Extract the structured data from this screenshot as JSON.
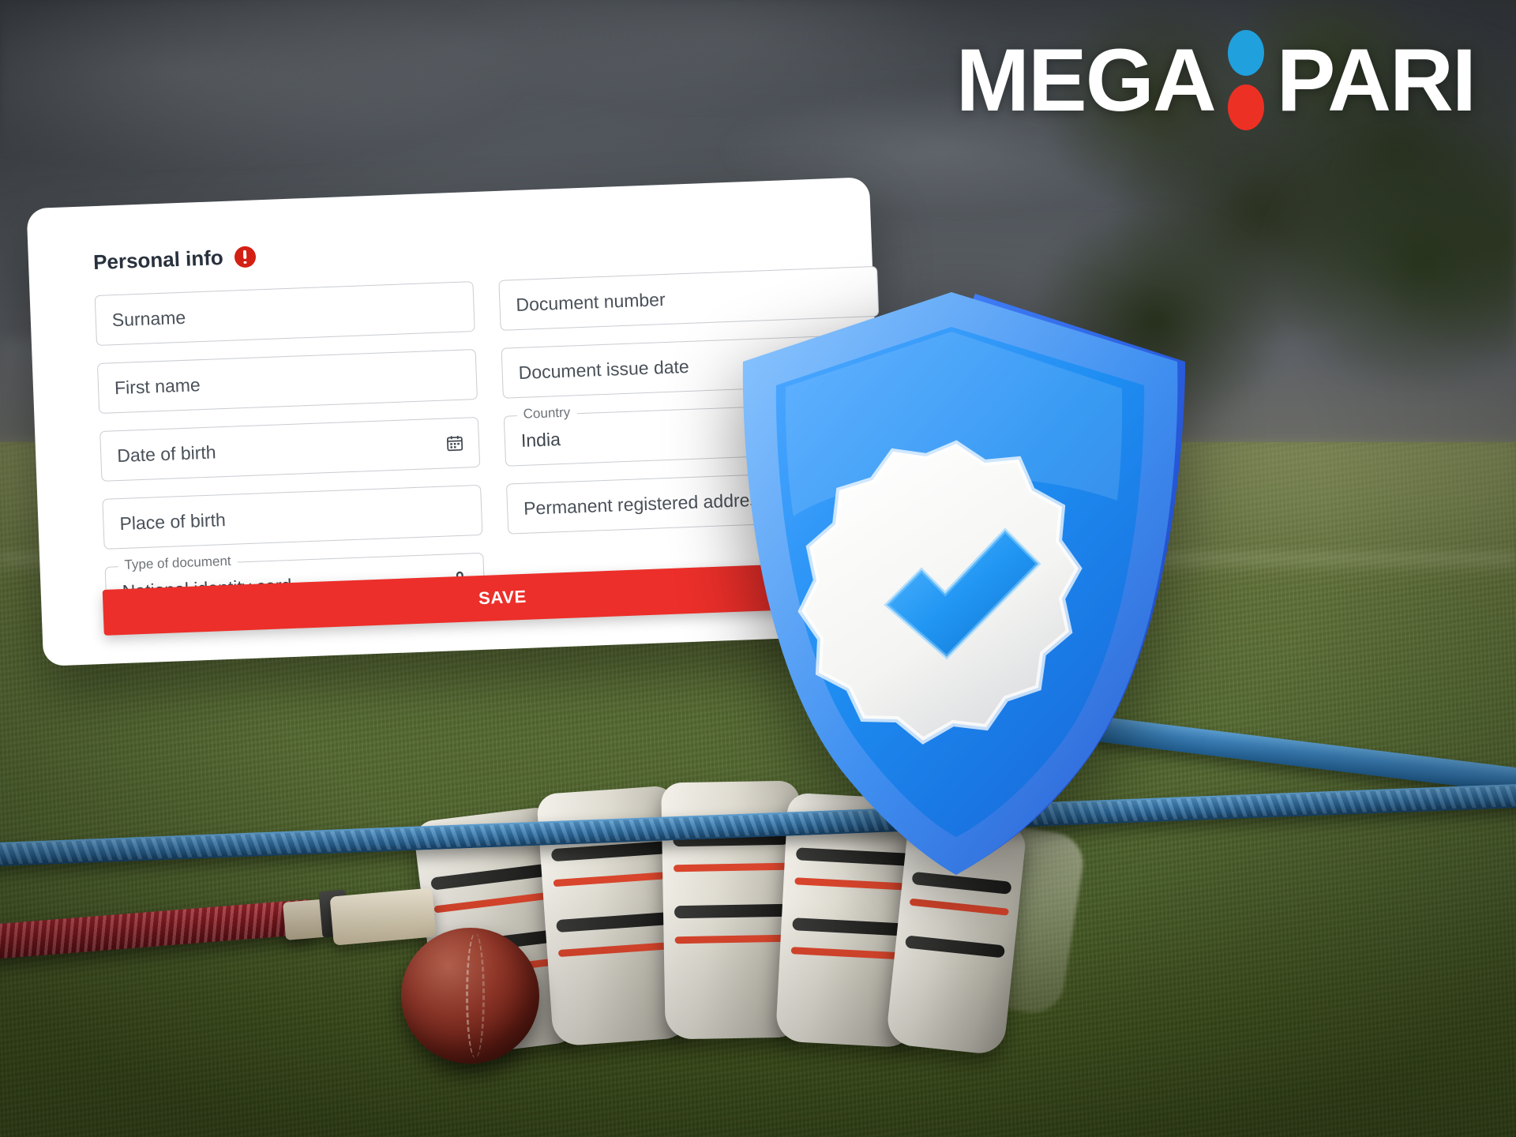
{
  "brand": {
    "name_left": "MEGA",
    "name_right": "PARI",
    "dot_top_color": "#20a0dd",
    "dot_bottom_color": "#ed3024"
  },
  "card": {
    "title": "Personal info",
    "alert_icon": "alert-circle-icon",
    "fields": [
      {
        "id": "surname",
        "placeholder": "Surname",
        "value": "",
        "label": "",
        "icon": ""
      },
      {
        "id": "document-number",
        "placeholder": "Document number",
        "value": "",
        "label": "",
        "icon": ""
      },
      {
        "id": "first-name",
        "placeholder": "First name",
        "value": "",
        "label": "",
        "icon": ""
      },
      {
        "id": "document-issue-date",
        "placeholder": "Document issue date",
        "value": "",
        "label": "",
        "icon": "calendar-icon"
      },
      {
        "id": "date-of-birth",
        "placeholder": "Date of birth",
        "value": "",
        "label": "",
        "icon": "calendar-icon"
      },
      {
        "id": "country",
        "placeholder": "",
        "value": "India",
        "label": "Country",
        "icon": ""
      },
      {
        "id": "place-of-birth",
        "placeholder": "Place of birth",
        "value": "",
        "label": "",
        "icon": ""
      },
      {
        "id": "permanent-registered-address",
        "placeholder": "Permanent registered address",
        "value": "",
        "label": "",
        "icon": ""
      },
      {
        "id": "type-of-document",
        "placeholder": "",
        "value": "National identity card",
        "label": "Type of document",
        "icon": "lock-icon"
      }
    ],
    "save_label": "SAVE",
    "save_color": "#ec2f2a"
  },
  "badge": {
    "icon": "verified-shield-check-icon",
    "shield_color": "#1f86f0",
    "check_color": "#2196f3"
  }
}
